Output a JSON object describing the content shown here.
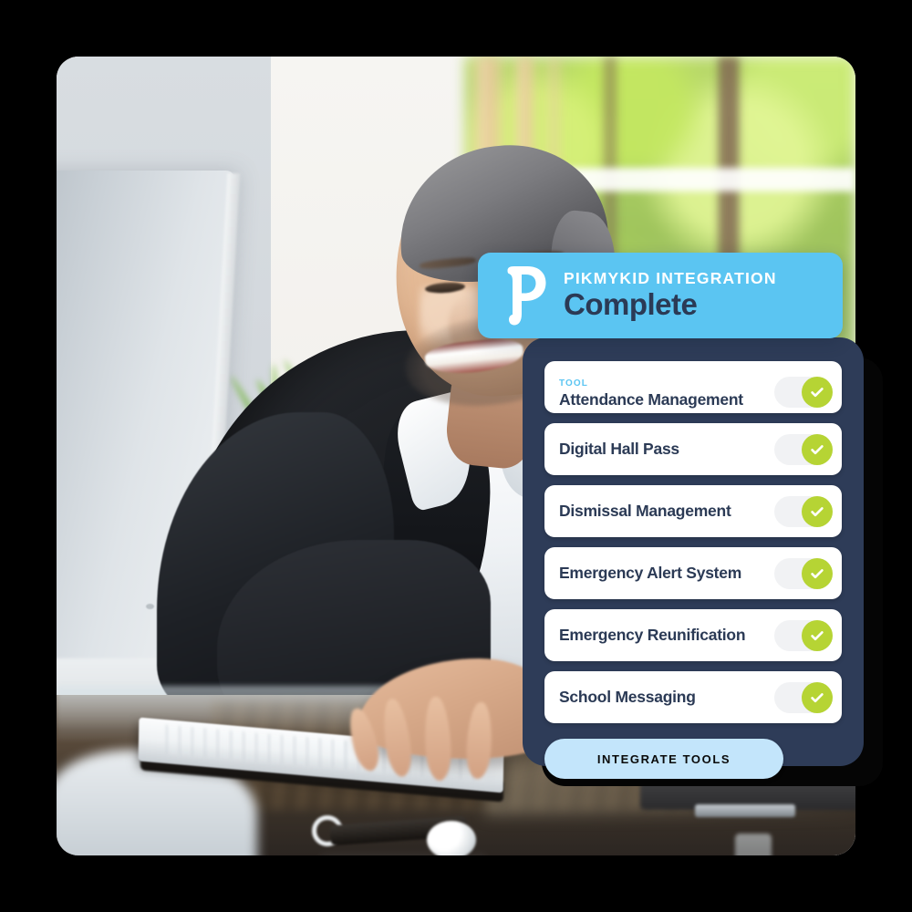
{
  "banner": {
    "logo_icon": "pikmykid-p-logo-icon",
    "eyebrow": "PIKMYKID INTEGRATION",
    "title": "Complete",
    "bg_color": "#5BC5F2",
    "eyebrow_color": "#FFFFFF",
    "title_color": "#2B3A55"
  },
  "panel": {
    "bg_color": "#2E3C58",
    "eyebrow": "TOOL",
    "eyebrow_color": "#5BC5F2",
    "tools": [
      {
        "label": "Attendance Management",
        "eyebrow": "TOOL",
        "enabled": true,
        "toggle_state": "on"
      },
      {
        "label": "Digital Hall Pass",
        "eyebrow": "",
        "enabled": true,
        "toggle_state": "on"
      },
      {
        "label": "Dismissal Management",
        "eyebrow": "",
        "enabled": true,
        "toggle_state": "on"
      },
      {
        "label": "Emergency Alert System",
        "eyebrow": "",
        "enabled": true,
        "toggle_state": "on"
      },
      {
        "label": "Emergency Reunification",
        "eyebrow": "",
        "enabled": true,
        "toggle_state": "on"
      },
      {
        "label": "School Messaging",
        "eyebrow": "",
        "enabled": true,
        "toggle_state": "on"
      }
    ],
    "toggle": {
      "track_color": "#F1F2F4",
      "knob_color": "#B6D434",
      "check_icon": "check-icon"
    },
    "cta": {
      "label": "INTEGRATE TOOLS",
      "bg_color": "#C3E5FB",
      "text_color": "#0A0A0A"
    }
  },
  "photo": {
    "alt": "Smiling man in dark suit working at a desktop computer by a sunlit window",
    "card_radius_px": 24
  }
}
